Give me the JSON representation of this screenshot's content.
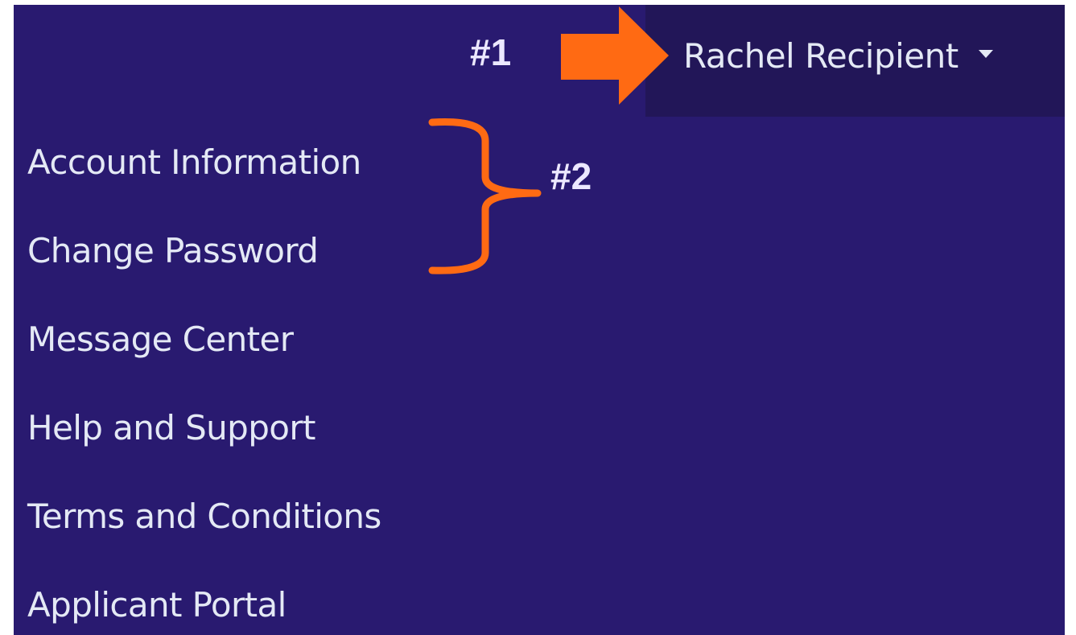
{
  "header": {
    "user_name": "Rachel Recipient",
    "user_menu_icon": "caret-down-icon"
  },
  "menu": {
    "items": [
      {
        "label": "Account Information"
      },
      {
        "label": "Change Password"
      },
      {
        "label": "Message Center"
      },
      {
        "label": "Help and Support"
      },
      {
        "label": "Terms and Conditions"
      },
      {
        "label": "Applicant Portal"
      }
    ]
  },
  "annotations": {
    "marker_1": "#1",
    "marker_2": "#2",
    "arrow_icon": "arrow-right-icon",
    "brace_icon": "curly-brace-icon",
    "accent_color": "#ff6a13"
  },
  "colors": {
    "panel_background": "#291a70",
    "user_menu_background": "#221658",
    "text": "#e4e9f5"
  }
}
